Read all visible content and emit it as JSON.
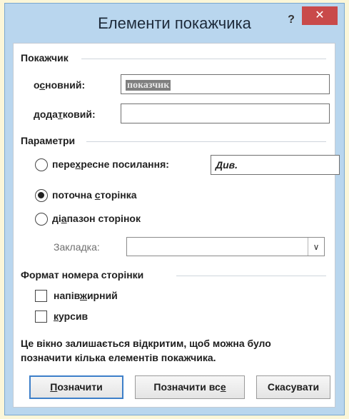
{
  "dialog": {
    "title": "Елементи покажчика",
    "help_glyph": "?",
    "close_glyph": "✕"
  },
  "index_section": {
    "title": "Покажчик",
    "main_label_pre": "о",
    "main_label_u": "с",
    "main_label_post": "новний:",
    "main_value": "показчик",
    "sub_label_pre": "дода",
    "sub_label_u": "т",
    "sub_label_post": "ковий:",
    "sub_value": ""
  },
  "options_section": {
    "title": "Параметри",
    "cross_ref_pre": "пере",
    "cross_ref_u": "х",
    "cross_ref_post": "ресне посилання:",
    "cross_ref_value": "Див.",
    "current_page_pre": "поточна ",
    "current_page_u": "с",
    "current_page_post": "торінка",
    "page_range_pre": "ді",
    "page_range_u": "а",
    "page_range_post": "пазон сторінок",
    "bookmark_label": "Закладка:",
    "bookmark_value": "",
    "selected": "current_page"
  },
  "format_section": {
    "title": "Формат номера сторінки",
    "bold_pre": "напів",
    "bold_u": "ж",
    "bold_post": "ирний",
    "italic_pre": "",
    "italic_u": "к",
    "italic_post": "урсив",
    "bold_checked": false,
    "italic_checked": false
  },
  "note": {
    "line1": "Це вікно залишається відкритим, щоб можна було",
    "line2": "позначити кілька елементів покажчика."
  },
  "buttons": {
    "mark_u": "П",
    "mark_post": "означити",
    "mark_all_pre": "Позначити вс",
    "mark_all_u": "е",
    "cancel": "Скасувати"
  },
  "colors": {
    "dialog_bg": "#b9d6ee",
    "close_bg": "#c94a4a",
    "default_button_border": "#3d7fc9"
  }
}
